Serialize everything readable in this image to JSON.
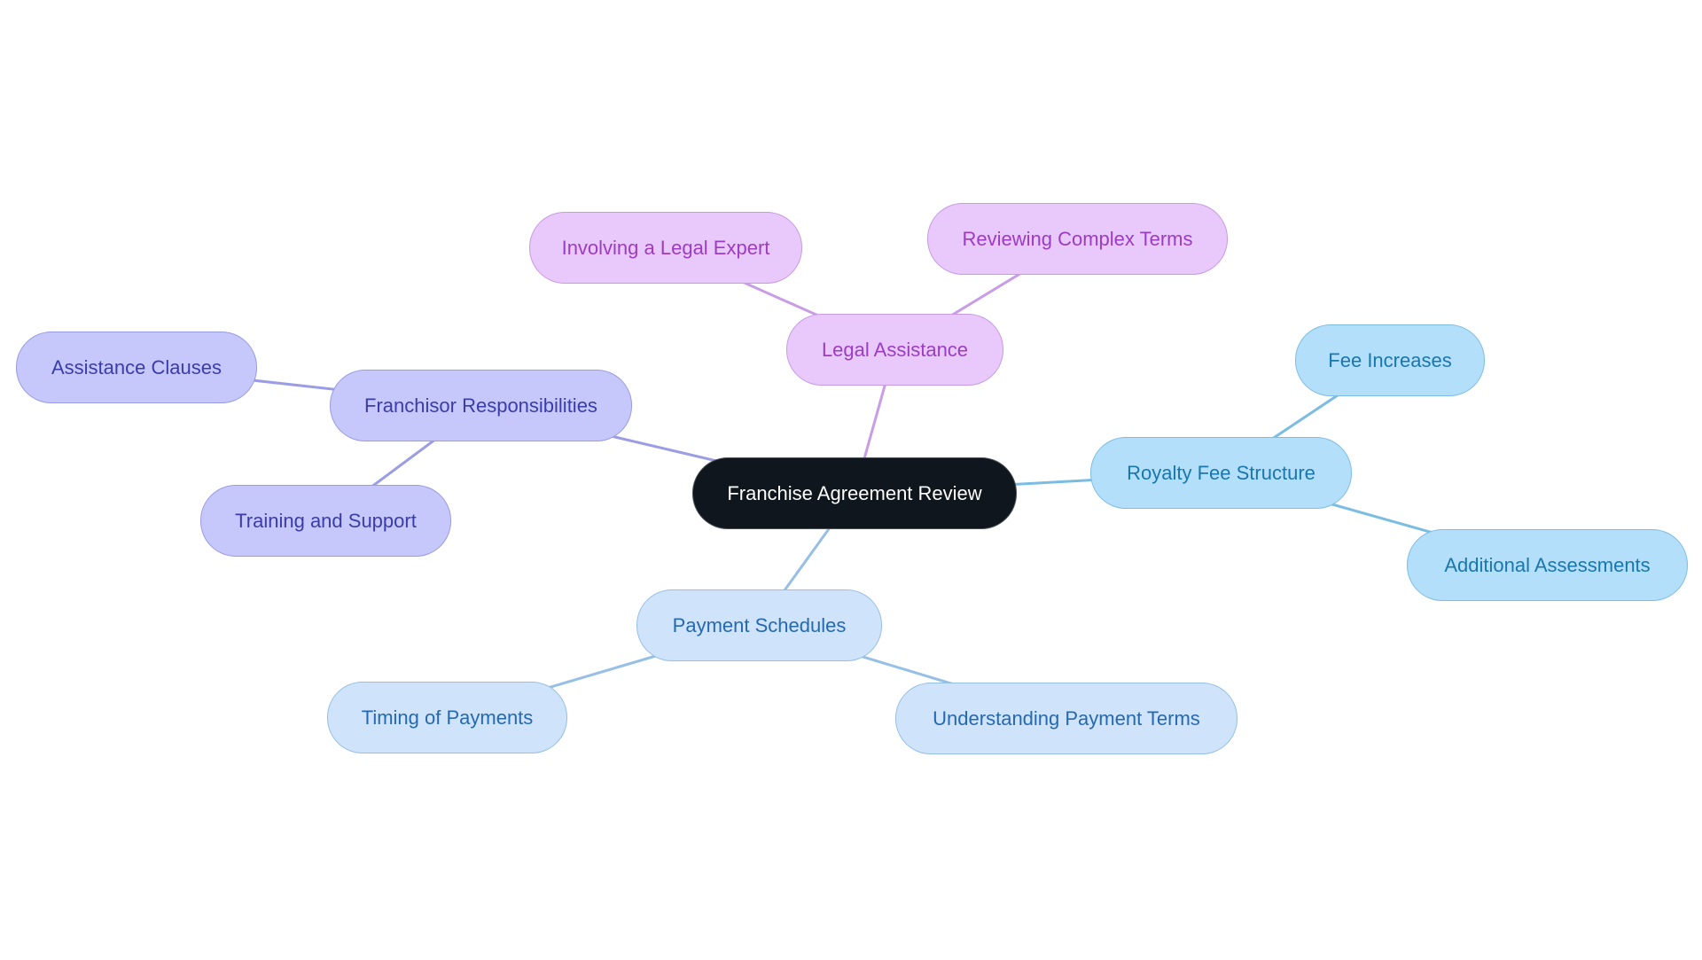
{
  "diagram": {
    "type": "mindmap",
    "root": {
      "id": "root",
      "label": "Franchise Agreement Review"
    },
    "branches": [
      {
        "id": "legal",
        "label": "Legal Assistance",
        "color": {
          "fill": "#e9c8fc",
          "border": "#c79be4",
          "text": "#9b3cc3",
          "edge": "#c89ce6"
        },
        "children": [
          {
            "id": "legal-expert",
            "label": "Involving a Legal Expert"
          },
          {
            "id": "complex-terms",
            "label": "Reviewing Complex Terms"
          }
        ]
      },
      {
        "id": "franchisor",
        "label": "Franchisor Responsibilities",
        "color": {
          "fill": "#c6c8fc",
          "border": "#979be3",
          "text": "#3b3cab",
          "edge": "#9a9ce6"
        },
        "children": [
          {
            "id": "assistance-clauses",
            "label": "Assistance Clauses"
          },
          {
            "id": "training-support",
            "label": "Training and Support"
          }
        ]
      },
      {
        "id": "royalty",
        "label": "Royalty Fee Structure",
        "color": {
          "fill": "#b4dffb",
          "border": "#7dbde3",
          "text": "#1877ae",
          "edge": "#7bbce3"
        },
        "children": [
          {
            "id": "fee-increases",
            "label": "Fee Increases"
          },
          {
            "id": "additional-assessments",
            "label": "Additional Assessments"
          }
        ]
      },
      {
        "id": "payment",
        "label": "Payment Schedules",
        "color": {
          "fill": "#cfe3fb",
          "border": "#96bfe6",
          "text": "#2569b0",
          "edge": "#96bfe6"
        },
        "children": [
          {
            "id": "timing-payments",
            "label": "Timing of Payments"
          },
          {
            "id": "payment-terms",
            "label": "Understanding Payment Terms"
          }
        ]
      }
    ],
    "root_color": {
      "fill": "#0f161d",
      "border": "#4a4f55",
      "text": "#ffffff"
    }
  }
}
